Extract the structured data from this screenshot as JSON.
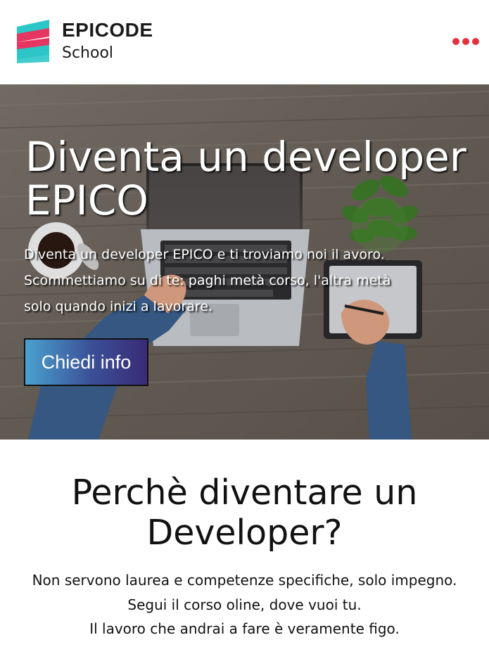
{
  "header": {
    "logo_title": "EPICODE",
    "logo_subtitle": "School",
    "menu_icon": "more-dots-icon",
    "accent_color": "#e2323f"
  },
  "hero": {
    "title": "Diventa un developer EPICO",
    "description_lines": [
      "Diventa un developer EPICO e ti troviamo noi il avoro.",
      "Scommettiamo su di te: paghi metà corso, l'altra metà",
      "solo quando inizi a lavorare."
    ],
    "cta_label": "Chiedi info",
    "background": "laptop-desk-photo"
  },
  "why": {
    "title_lines": [
      "Perchè diventare un",
      "Developer?"
    ],
    "text_lines": [
      "Non servono laurea e competenze specifiche, solo impegno.",
      "Segui il corso oline, dove vuoi tu.",
      "Il lavoro che andrai a fare è veramente figo."
    ]
  }
}
